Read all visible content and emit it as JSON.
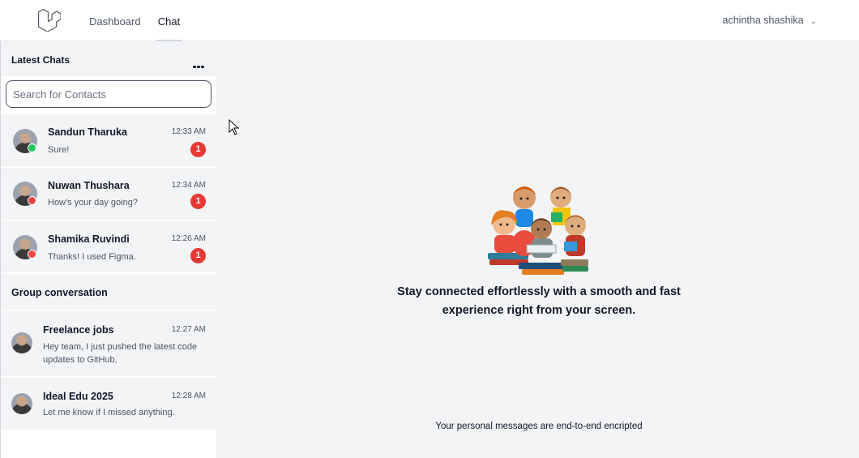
{
  "nav": {
    "links": [
      {
        "label": "Dashboard",
        "active": false
      },
      {
        "label": "Chat",
        "active": true
      }
    ],
    "user_name": "achintha shashika",
    "user_menu_icon": "chevron-down-icon"
  },
  "sidebar": {
    "latest_title": "Latest Chats",
    "more_icon": "more-horizontal-icon",
    "search": {
      "placeholder": "Search for Contacts",
      "value": ""
    },
    "chats": [
      {
        "name": "Sandun Tharuka",
        "message": "Sure!",
        "time": "12:33 AM",
        "unread": "1",
        "status": "online",
        "status_color": "#22c55e"
      },
      {
        "name": "Nuwan Thushara",
        "message": "How's your day going?",
        "time": "12:34 AM",
        "unread": "1",
        "status": "offline",
        "status_color": "#ef4444"
      },
      {
        "name": "Shamika Ruvindi",
        "message": "Thanks! I used Figma.",
        "time": "12:26 AM",
        "unread": "1",
        "status": "offline",
        "status_color": "#ef4444"
      }
    ],
    "group_title": "Group conversation",
    "groups": [
      {
        "name": "Freelance jobs",
        "message": "Hey team, I just pushed the latest code updates to GitHub.",
        "time": "12:27 AM"
      },
      {
        "name": "Ideal Edu 2025",
        "message": "Let me know if I missed anything.",
        "time": "12:28 AM"
      }
    ]
  },
  "main": {
    "illustration": "kids-reading-books-illustration",
    "tagline": "Stay connected effortlessly with a smooth and fast experience right from your screen.",
    "encryption_note": "Your personal messages are end-to-end encripted"
  },
  "colors": {
    "badge": "#e53935",
    "online": "#22c55e",
    "offline": "#ef4444",
    "background": "#f3f4f6"
  }
}
